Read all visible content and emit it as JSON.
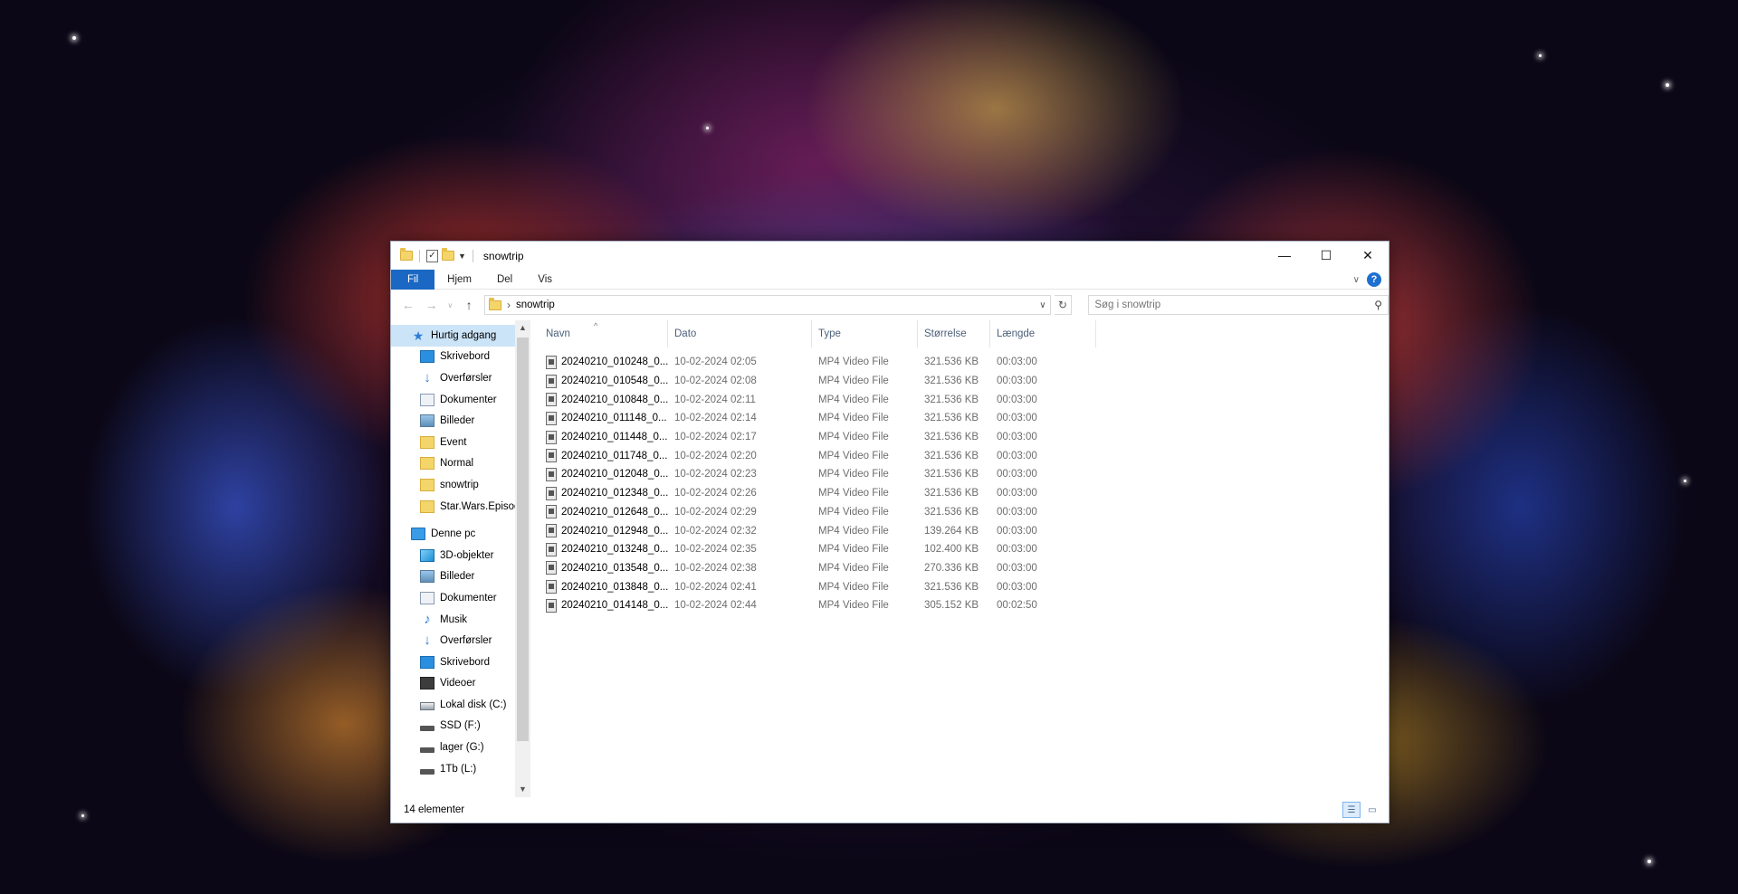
{
  "window": {
    "title": "snowtrip"
  },
  "caption": {
    "minimize": "—",
    "maximize": "☐",
    "close": "✕"
  },
  "ribbon": {
    "tabs": [
      "Fil",
      "Hjem",
      "Del",
      "Vis"
    ],
    "expand_icon": "∨",
    "help": "?"
  },
  "address": {
    "path": "snowtrip",
    "separator": "›"
  },
  "search": {
    "placeholder": "Søg i snowtrip"
  },
  "nav": {
    "quick_access": "Hurtig adgang",
    "quick_items": [
      {
        "label": "Skrivebord",
        "icon": "desktop-icon",
        "pinned": true
      },
      {
        "label": "Overførsler",
        "icon": "downloads-icon",
        "pinned": true
      },
      {
        "label": "Dokumenter",
        "icon": "documents-icon",
        "pinned": true
      },
      {
        "label": "Billeder",
        "icon": "pictures-icon",
        "pinned": true
      },
      {
        "label": "Event",
        "icon": "folder-icon",
        "pinned": false
      },
      {
        "label": "Normal",
        "icon": "folder-icon",
        "pinned": false
      },
      {
        "label": "snowtrip",
        "icon": "folder-icon",
        "pinned": false
      },
      {
        "label": "Star.Wars.Episod",
        "icon": "folder-icon",
        "pinned": false
      }
    ],
    "this_pc": "Denne pc",
    "pc_items": [
      {
        "label": "3D-objekter",
        "icon": "3d-objects-icon"
      },
      {
        "label": "Billeder",
        "icon": "pictures-icon"
      },
      {
        "label": "Dokumenter",
        "icon": "documents-icon"
      },
      {
        "label": "Musik",
        "icon": "music-icon"
      },
      {
        "label": "Overførsler",
        "icon": "downloads-icon"
      },
      {
        "label": "Skrivebord",
        "icon": "desktop-icon"
      },
      {
        "label": "Videoer",
        "icon": "videos-icon"
      },
      {
        "label": "Lokal disk (C:)",
        "icon": "local-disk-icon"
      },
      {
        "label": "SSD (F:)",
        "icon": "drive-icon"
      },
      {
        "label": "lager (G:)",
        "icon": "drive-icon"
      },
      {
        "label": "1Tb (L:)",
        "icon": "drive-icon"
      }
    ]
  },
  "columns": {
    "name": "Navn",
    "date": "Dato",
    "type": "Type",
    "size": "Størrelse",
    "length": "Længde"
  },
  "files": [
    {
      "name": "20240210_010248_0...",
      "date": "10-02-2024 02:05",
      "type": "MP4 Video File",
      "size": "321.536 KB",
      "length": "00:03:00"
    },
    {
      "name": "20240210_010548_0...",
      "date": "10-02-2024 02:08",
      "type": "MP4 Video File",
      "size": "321.536 KB",
      "length": "00:03:00"
    },
    {
      "name": "20240210_010848_0...",
      "date": "10-02-2024 02:11",
      "type": "MP4 Video File",
      "size": "321.536 KB",
      "length": "00:03:00"
    },
    {
      "name": "20240210_011148_0...",
      "date": "10-02-2024 02:14",
      "type": "MP4 Video File",
      "size": "321.536 KB",
      "length": "00:03:00"
    },
    {
      "name": "20240210_011448_0...",
      "date": "10-02-2024 02:17",
      "type": "MP4 Video File",
      "size": "321.536 KB",
      "length": "00:03:00"
    },
    {
      "name": "20240210_011748_0...",
      "date": "10-02-2024 02:20",
      "type": "MP4 Video File",
      "size": "321.536 KB",
      "length": "00:03:00"
    },
    {
      "name": "20240210_012048_0...",
      "date": "10-02-2024 02:23",
      "type": "MP4 Video File",
      "size": "321.536 KB",
      "length": "00:03:00"
    },
    {
      "name": "20240210_012348_0...",
      "date": "10-02-2024 02:26",
      "type": "MP4 Video File",
      "size": "321.536 KB",
      "length": "00:03:00"
    },
    {
      "name": "20240210_012648_0...",
      "date": "10-02-2024 02:29",
      "type": "MP4 Video File",
      "size": "321.536 KB",
      "length": "00:03:00"
    },
    {
      "name": "20240210_012948_0...",
      "date": "10-02-2024 02:32",
      "type": "MP4 Video File",
      "size": "139.264 KB",
      "length": "00:03:00"
    },
    {
      "name": "20240210_013248_0...",
      "date": "10-02-2024 02:35",
      "type": "MP4 Video File",
      "size": "102.400 KB",
      "length": "00:03:00"
    },
    {
      "name": "20240210_013548_0...",
      "date": "10-02-2024 02:38",
      "type": "MP4 Video File",
      "size": "270.336 KB",
      "length": "00:03:00"
    },
    {
      "name": "20240210_013848_0...",
      "date": "10-02-2024 02:41",
      "type": "MP4 Video File",
      "size": "321.536 KB",
      "length": "00:03:00"
    },
    {
      "name": "20240210_014148_0...",
      "date": "10-02-2024 02:44",
      "type": "MP4 Video File",
      "size": "305.152 KB",
      "length": "00:02:50"
    }
  ],
  "status": {
    "count": "14 elementer"
  },
  "colors": {
    "accent": "#1a68c4",
    "selection": "#cce4f7"
  }
}
